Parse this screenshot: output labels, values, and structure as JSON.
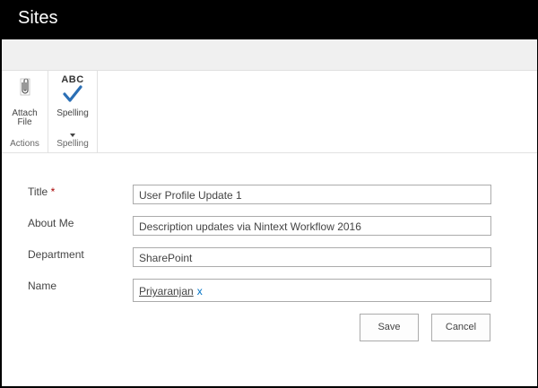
{
  "header": {
    "title": "Sites"
  },
  "ribbon": {
    "groups": [
      {
        "label": "Actions",
        "button": {
          "label_line1": "Attach",
          "label_line2": "File",
          "icon": "paperclip-icon"
        }
      },
      {
        "label": "Spelling",
        "button": {
          "label": "Spelling",
          "icon_text": "ABC",
          "icon": "spellcheck-icon"
        }
      }
    ]
  },
  "form": {
    "fields": [
      {
        "label": "Title",
        "required_marker": "*",
        "value": "User Profile Update 1"
      },
      {
        "label": "About Me",
        "value": "Description updates via Nintext Workflow 2016"
      },
      {
        "label": "Department",
        "value": "SharePoint"
      },
      {
        "label": "Name",
        "person": "Priyaranjan",
        "remove": "x"
      }
    ],
    "save_label": "Save",
    "cancel_label": "Cancel"
  },
  "colors": {
    "header_bg": "#000000",
    "accent": "#0072c6",
    "required": "#a80000"
  }
}
